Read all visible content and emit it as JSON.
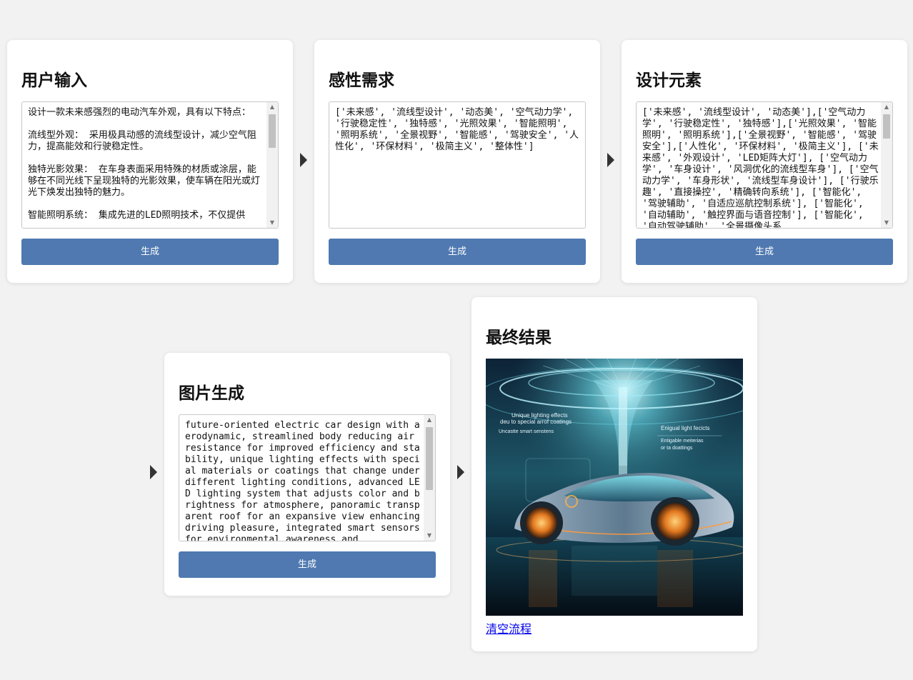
{
  "cards": {
    "user_input": {
      "title": "用户输入",
      "text": "设计一款未来感强烈的电动汽车外观，具有以下特点：\n\n流线型外观： 采用极具动感的流线型设计，减少空气阻力，提高能效和行驶稳定性。\n\n独特光影效果： 在车身表面采用特殊的材质或涂层，能够在不同光线下呈现独特的光影效果，使车辆在阳光或灯光下焕发出独特的魅力。\n\n智能照明系统： 集成先进的LED照明技术，不仅提供",
      "button": "生成"
    },
    "emotional_needs": {
      "title": "感性需求",
      "text": "['未来感', '流线型设计', '动态美', '空气动力学', '行驶稳定性', '独特感', '光照效果', '智能照明', '照明系统', '全景视野', '智能感', '驾驶安全', '人性化', '环保材料', '极简主义', '整体性']",
      "button": "生成"
    },
    "design_elements": {
      "title": "设计元素",
      "text": "['未来感', '流线型设计', '动态美'],['空气动力学', '行驶稳定性', '独特感'],['光照效果', '智能照明', '照明系统'],['全景视野', '智能感', '驾驶安全'],['人性化', '环保材料', '极简主义'], ['未来感', '外观设计', 'LED矩阵大灯'], ['空气动力学', '车身设计', '风洞优化的流线型车身'], ['空气动力学', '车身形状', '流线型车身设计'], ['行驶乐趣', '直接操控', '精确转向系统'], ['智能化', '驾驶辅助', '自适应巡航控制系统'], ['智能化', '自动辅助', '触控界面与语音控制'], ['智能化', '自动驾驶辅助', '全景摄像头系",
      "button": "生成"
    },
    "image_generation": {
      "title": "图片生成",
      "text": "future-oriented electric car design with aerodynamic, streamlined body reducing air resistance for improved efficiency and stability, unique lighting effects with special materials or coatings that change under different lighting conditions, advanced LED lighting system that adjusts color and brightness for atmosphere, panoramic transparent roof for an expansive view enhancing driving pleasure, integrated smart sensors for environmental awareness and",
      "button": "生成"
    },
    "final_result": {
      "title": "最终结果",
      "image_labels": {
        "left_1": "Unique lighting effects",
        "left_2": "deu to special arrof coatings",
        "left_3": "Uncastte smart senstens",
        "right_1": "Enigual light fecicts",
        "right_2": "Entigable meiterias",
        "right_3": "or ta doattings"
      },
      "link": "清空流程"
    }
  },
  "colors": {
    "button": "#4f79b0",
    "background": "#f2f2f2",
    "link": "#0000ee"
  },
  "icons": {
    "flow_arrow": "play-triangle"
  }
}
